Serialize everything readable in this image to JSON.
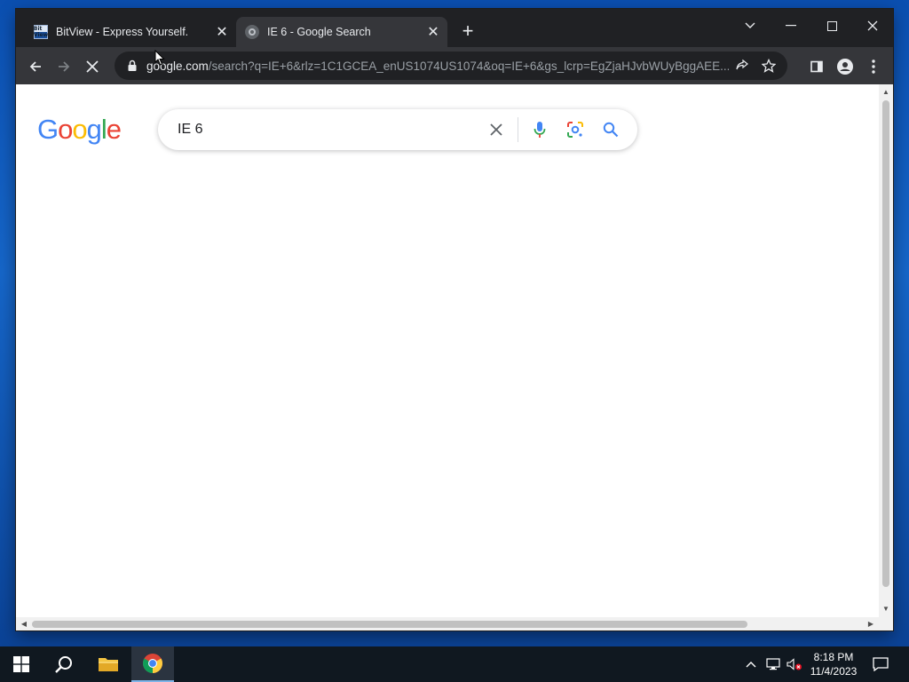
{
  "browser": {
    "tabs": [
      {
        "title": "BitView - Express Yourself.",
        "favicon": "bitview-icon",
        "favicon_text": "Bit View",
        "active": false
      },
      {
        "title": "IE 6 - Google Search",
        "favicon": "loading-google-icon",
        "active": true
      }
    ],
    "new_tab_label": "+",
    "window_controls": {
      "tab_search": "⌄",
      "minimize": "—",
      "maximize": "☐",
      "close": "✕"
    },
    "address_bar": {
      "host": "google.com",
      "path": "/search?q=IE+6&rlz=1C1GCEA_enUS1074US1074&oq=IE+6&gs_lcrp=EgZjaHJvbWUyBggAEE..."
    },
    "state": "loading"
  },
  "page": {
    "logo_letters": [
      {
        "ch": "G",
        "color": "#4285F4"
      },
      {
        "ch": "o",
        "color": "#EA4335"
      },
      {
        "ch": "o",
        "color": "#FBBC05"
      },
      {
        "ch": "g",
        "color": "#4285F4"
      },
      {
        "ch": "l",
        "color": "#34A853"
      },
      {
        "ch": "e",
        "color": "#EA4335"
      }
    ],
    "search": {
      "value": "IE 6"
    }
  },
  "taskbar": {
    "apps": [
      "start",
      "search",
      "file-explorer",
      "chrome"
    ],
    "clock": {
      "time": "8:18 PM",
      "date": "11/4/2023"
    }
  }
}
